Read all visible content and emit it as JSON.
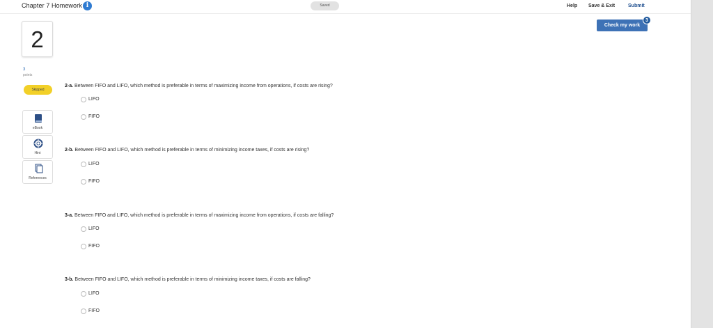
{
  "header": {
    "title": "Chapter 7 Homework",
    "info_icon": "i",
    "saved": "Saved",
    "help": "Help",
    "save_exit": "Save & Exit",
    "submit": "Submit"
  },
  "check_work": {
    "label": "Check my work",
    "badge": "3"
  },
  "question": {
    "number": "2",
    "points_value": "3",
    "points_label": "points",
    "status": "Skipped"
  },
  "tools": [
    {
      "label": "eBook",
      "icon": "book-icon"
    },
    {
      "label": "Hint",
      "icon": "lifebuoy-icon"
    },
    {
      "label": "References",
      "icon": "document-icon"
    }
  ],
  "parts": [
    {
      "id": "2-a.",
      "text": " Between FIFO and LIFO, which method is preferable in terms of maximizing income from operations, if costs are rising?",
      "options": [
        "LIFO",
        "FIFO"
      ]
    },
    {
      "id": "2-b.",
      "text": " Between FIFO and LIFO, which method is preferable in terms of minimizing income taxes, if costs are rising?",
      "options": [
        "LIFO",
        "FIFO"
      ]
    },
    {
      "id": "3-a.",
      "text": " Between FIFO and LIFO, which method is preferable in terms of maximizing income from operations, if costs are falling?",
      "options": [
        "LIFO",
        "FIFO"
      ]
    },
    {
      "id": "3-b.",
      "text": " Between FIFO and LIFO, which method is preferable in terms of minimizing income taxes, if costs are falling?",
      "options": [
        "LIFO",
        "FIFO"
      ]
    }
  ],
  "colors": {
    "accent": "#3e72b6",
    "skipped": "#f2d028",
    "info": "#2f7bd1"
  }
}
